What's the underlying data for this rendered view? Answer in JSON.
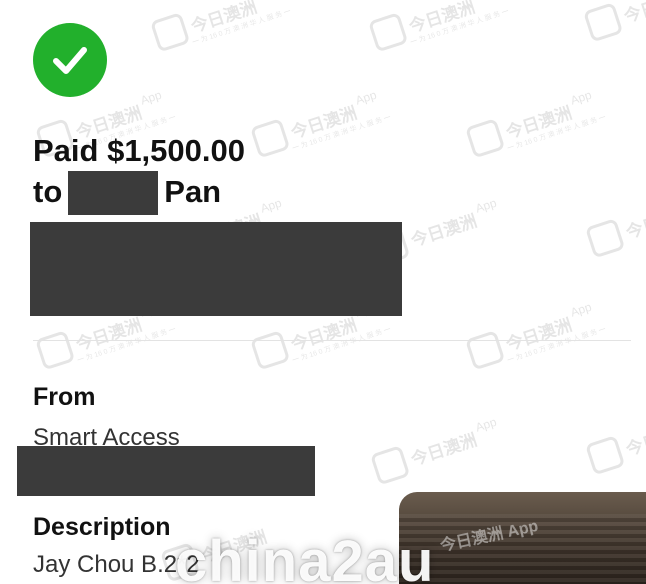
{
  "status": {
    "icon": "checkmark-icon",
    "color": "#22b02c"
  },
  "payment": {
    "paid_text": "Paid $1,500.00",
    "to_label": "to",
    "recipient_suffix": "Pan"
  },
  "details": {
    "from_label": "From",
    "from_value": "Smart Access",
    "description_label": "Description",
    "description_value": "Jay Chou B.2*2"
  },
  "watermarks": {
    "app_name": "今日澳洲",
    "app_suffix": "App",
    "tagline": "一 为 16 0 万 澳 洲 华 人 服 务 一",
    "site": "china2au"
  }
}
